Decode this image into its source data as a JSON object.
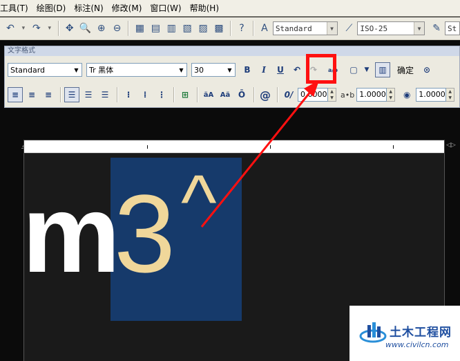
{
  "menubar": {
    "items": [
      "工具(T)",
      "绘图(D)",
      "标注(N)",
      "修改(M)",
      "窗口(W)",
      "帮助(H)"
    ]
  },
  "toolbar": {
    "text_style": "Standard",
    "dim_style": "ISO-25",
    "table_style": "St"
  },
  "text_formatting": {
    "title": "文字格式",
    "style": "Standard",
    "font": "Tr 黑体",
    "height": "30",
    "bold_label": "B",
    "italic_label": "I",
    "underline_label": "U",
    "undo_label": "↶",
    "stack_label": "a/b",
    "ok_label": "确定",
    "oblique_value": "0.0000",
    "tracking_label": "a•b",
    "tracking_value": "1.0000",
    "width_value": "1.0000",
    "at_symbol": "@",
    "oblique_symbol": "0/"
  },
  "editor": {
    "text_m": "m",
    "text_3": "3",
    "text_caret": "^"
  },
  "watermark": {
    "title": "土木工程网",
    "url": "www.civilcn.com"
  },
  "colors": {
    "highlight": "#ff1010",
    "selection": "#163a6b",
    "text_fill": "#f0d79a"
  }
}
